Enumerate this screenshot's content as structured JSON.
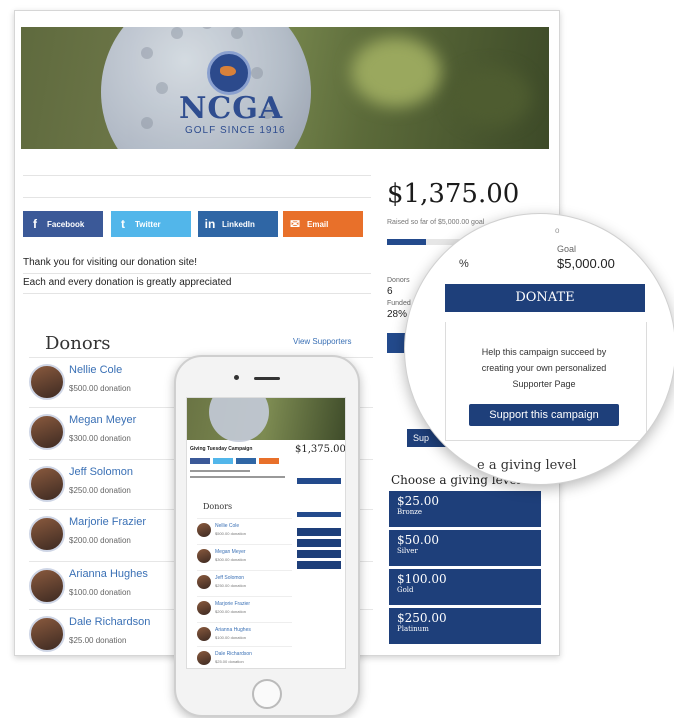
{
  "hero": {
    "logo_text": "NCGA",
    "logo_sub": "GOLF SINCE 1916"
  },
  "share": [
    {
      "label": "Facebook",
      "icon": "f"
    },
    {
      "label": "Twitter",
      "icon": "t"
    },
    {
      "label": "LinkedIn",
      "icon": "in"
    },
    {
      "label": "Email",
      "icon": "✉"
    }
  ],
  "messages": [
    "Thank you for visiting our donation site!",
    "Each and every donation is greatly appreciated"
  ],
  "summary": {
    "amount": "$1,375.00",
    "raised_note": "Raised so far of $5,000.00 goal",
    "progress_fraction": 0.275,
    "donors_label": "Donors",
    "donors_value": "6",
    "funded_label": "Funded",
    "funded_value": "28%"
  },
  "donors_title": "Donors",
  "view_supporters": "View Supporters",
  "donors": [
    {
      "name": "Nellie Cole",
      "amount": "$500.00 donation"
    },
    {
      "name": "Megan Meyer",
      "amount": "$300.00 donation"
    },
    {
      "name": "Jeff Solomon",
      "amount": "$250.00 donation"
    },
    {
      "name": "Marjorie Frazier",
      "amount": "$200.00 donation"
    },
    {
      "name": "Arianna Hughes",
      "amount": "$100.00 donation"
    },
    {
      "name": "Dale Richardson",
      "amount": "$25.00 donation"
    }
  ],
  "giving_title": "Choose a giving level",
  "levels": [
    {
      "value": "$25.00",
      "name": "Bronze"
    },
    {
      "value": "$50.00",
      "name": "Silver"
    },
    {
      "value": "$100.00",
      "name": "Gold"
    },
    {
      "value": "$250.00",
      "name": "Platinum"
    }
  ],
  "support_peek": "Sup",
  "magnifier": {
    "goal_label": "Goal",
    "goal_value": "$5,000.00",
    "pct_fragment": "%",
    "donate": "DONATE",
    "help_text": "Help this campaign succeed by creating your own personalized Supporter Page",
    "support_button": "Support this campaign",
    "choose_fragment": "e a giving level"
  },
  "phone": {
    "title": "Giving Tuesday Campaign",
    "amount": "$1,375.00",
    "donors_title": "Donors"
  },
  "colors": {
    "navy": "#1e3f7a",
    "facebook": "#3b5998",
    "twitter": "#52b6ea",
    "linkedin": "#2f66a5",
    "email": "#e8702a",
    "link": "#3a70b5"
  }
}
